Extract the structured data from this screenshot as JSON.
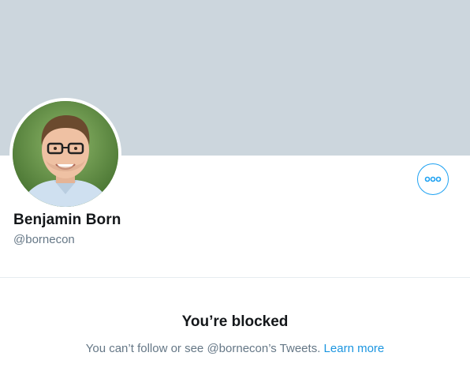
{
  "profile": {
    "display_name": "Benjamin Born",
    "handle": "@bornecon",
    "avatar_icon": "profile-photo",
    "more_button_icon": "more-dots-icon"
  },
  "blocked": {
    "title": "You’re blocked",
    "message": "You can’t follow or see @bornecon’s Tweets.",
    "link_label": "Learn more"
  },
  "colors": {
    "banner": "#ccd6dd",
    "accent": "#1da1f2",
    "link": "#1b95e0",
    "secondary_text": "#657786",
    "primary_text": "#14171a"
  }
}
